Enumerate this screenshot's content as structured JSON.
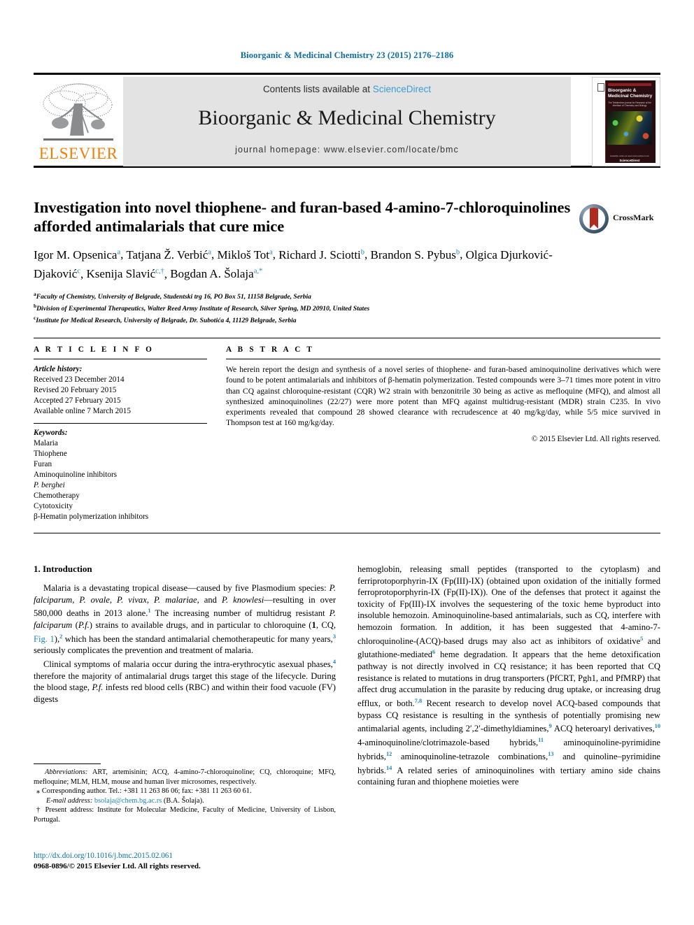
{
  "running_head": "Bioorganic & Medicinal Chemistry 23 (2015) 2176–2186",
  "masthead": {
    "contents_prefix": "Contents lists available at ",
    "sciencedirect": "ScienceDirect",
    "journal_title": "Bioorganic & Medicinal Chemistry",
    "homepage": "journal homepage: www.elsevier.com/locate/bmc",
    "publisher_wordmark": "ELSEVIER",
    "cover": {
      "title": "Bioorganic & Medicinal Chemistry",
      "subtitle": "The Tetrahedron journal for Research at the Interface of Chemistry and Biology",
      "footer_small": "Available online at www.sciencedirect.com",
      "footer_brand": "ScienceDirect"
    },
    "accent_blue": "#0d6ea4",
    "link_blue": "#3d9bd6",
    "elsevier_orange": "#f07f09",
    "band_grey": "#e3e3e3"
  },
  "crossmark": {
    "label": "CrossMark"
  },
  "article": {
    "title": "Investigation into novel thiophene- and furan-based 4-amino-7-chloroquinolines afforded antimalarials that cure mice",
    "authors_line1_parts": [
      {
        "name": "Igor M. Opsenica",
        "sup": "a"
      },
      {
        "name": "Tatjana Ž. Verbić",
        "sup": "a"
      },
      {
        "name": "Mikloš Tot",
        "sup": "a"
      },
      {
        "name": "Richard J. Sciotti",
        "sup": "b"
      },
      {
        "name": "Brandon S. Pybus",
        "sup": "b"
      }
    ],
    "authors_line2_parts": [
      {
        "name": "Olgica Djurković-Djaković",
        "sup": "c"
      },
      {
        "name": "Ksenija Slavić",
        "sup": "c,†"
      },
      {
        "name": "Bogdan A. Šolaja",
        "sup": "a,*"
      }
    ],
    "affiliations": [
      {
        "marker": "a",
        "text": "Faculty of Chemistry, University of Belgrade, Studentski trg 16, PO Box 51, 11158 Belgrade, Serbia"
      },
      {
        "marker": "b",
        "text": "Division of Experimental Therapeutics, Walter Reed Army Institute of Research, Silver Spring, MD 20910, United States"
      },
      {
        "marker": "c",
        "text": "Institute for Medical Research, University of Belgrade, Dr. Subotića 4, 11129 Belgrade, Serbia"
      }
    ]
  },
  "article_info": {
    "heading": "A R T I C L E   I N F O",
    "history_label": "Article history:",
    "history": [
      "Received 23 December 2014",
      "Revised 20 February 2015",
      "Accepted 27 February 2015",
      "Available online 7 March 2015"
    ],
    "keywords_label": "Keywords:",
    "keywords": [
      "Malaria",
      "Thiophene",
      "Furan",
      "Aminoquinoline inhibitors",
      "P. berghei",
      "Chemotherapy",
      "Cytotoxicity",
      "β-Hematin polymerization inhibitors"
    ]
  },
  "abstract": {
    "heading": "A B S T R A C T",
    "text": "We herein report the design and synthesis of a novel series of thiophene- and furan-based aminoquinoline derivatives which were found to be potent antimalarials and inhibitors of β-hematin polymerization. Tested compounds were 3–71 times more potent in vitro than CQ against chloroquine-resistant (CQR) W2 strain with benzonitrile 30 being as active as mefloquine (MFQ), and almost all synthesized aminoquinolines (22/27) were more potent than MFQ against multidrug-resistant (MDR) strain C235. In vivo experiments revealed that compound 28 showed clearance with recrudescence at 40 mg/kg/day, while 5/5 mice survived in Thompson test at 160 mg/kg/day.",
    "copyright": "© 2015 Elsevier Ltd. All rights reserved."
  },
  "body": {
    "section_heading": "1. Introduction",
    "left_paragraph_1": "Malaria is a devastating tropical disease—caused by five Plasmodium species: P. falciparum, P. ovale, P. vivax, P. malariae, and P. knowlesi—resulting in over 580,000 deaths in 2013 alone.1 The increasing number of multidrug resistant P. falciparum (P.f.) strains to available drugs, and in particular to chloroquine (1, CQ, Fig. 1),2 which has been the standard antimalarial chemotherapeutic for many years,3 seriously complicates the prevention and treatment of malaria.",
    "left_paragraph_2": "Clinical symptoms of malaria occur during the intra-erythrocytic asexual phases,4 therefore the majority of antimalarial drugs target this stage of the lifecycle. During the blood stage, P.f. infests red blood cells (RBC) and within their food vacuole (FV) digests",
    "right_paragraph_1": "hemoglobin, releasing small peptides (transported to the cytoplasm) and ferriprotoporphyrin-IX (Fp(III)-IX) (obtained upon oxidation of the initially formed ferroprotoporphyrin-IX (Fp(II)-IX)). One of the defenses that protect it against the toxicity of Fp(III)-IX involves the sequestering of the toxic heme byproduct into insoluble hemozoin. Aminoquinoline-based antimalarials, such as CQ, interfere with hemozoin formation. In addition, it has been suggested that 4-amino-7-chloroquinoline-(ACQ)-based drugs may also act as inhibitors of oxidative5 and glutathione-mediated6 heme degradation. It appears that the heme detoxification pathway is not directly involved in CQ resistance; it has been reported that CQ resistance is related to mutations in drug transporters (PfCRT, Pgh1, and PfMRP) that affect drug accumulation in the parasite by reducing drug uptake, or increasing drug efflux, or both.7,8 Recent research to develop novel ACQ-based compounds that bypass CQ resistance is resulting in the synthesis of potentially promising new antimalarial agents, including 2′,2′-dimethyldiamines,9 ACQ heteroaryl derivatives,10 4-aminoquinoline/clotrimazole-based hybrids,11 aminoquinoline-pyrimidine hybrids,12 aminoquinoline-tetrazole combinations,13 and quinoline–pyrimidine hybrids.14 A related series of aminoquinolines with tertiary amino side chains containing furan and thiophene moieties were"
  },
  "footnotes": {
    "abbreviations_label": "Abbreviations:",
    "abbreviations_text": "ART, artemisinin; ACQ, 4-amino-7-chloroquinoline; CQ, chloroquine; MFQ, mefloquine; MLM, HLM, mouse and human liver microsomes, respectively.",
    "corresponding": "Corresponding author. Tel.: +381 11 263 86 06; fax: +381 11 263 60 61.",
    "email_label": "E-mail address:",
    "email": "bsolaja@chem.bg.ac.rs",
    "email_owner": "(B.A. Šolaja).",
    "present_address": "Present address: Institute for Molecular Medicine, Faculty of Medicine, University of Lisbon, Portugal."
  },
  "footer": {
    "doi": "http://dx.doi.org/10.1016/j.bmc.2015.02.061",
    "issn_copyright": "0968-0896/© 2015 Elsevier Ltd. All rights reserved."
  }
}
